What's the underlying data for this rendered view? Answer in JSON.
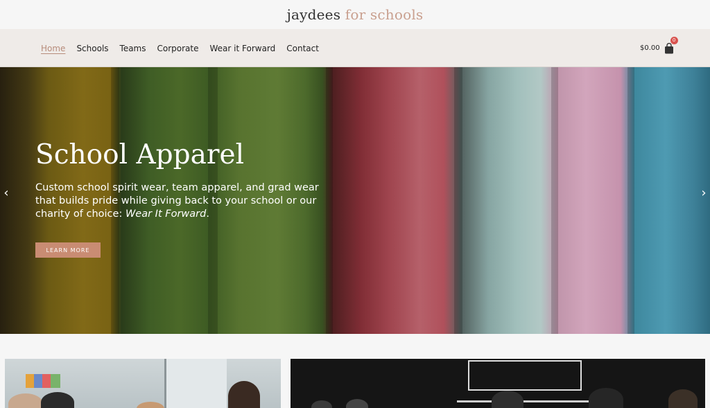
{
  "brand": {
    "logo_main": "jaydees",
    "logo_accent": "for schools",
    "accent_color": "#c9a08f"
  },
  "nav": {
    "items": [
      {
        "label": "Home",
        "active": true
      },
      {
        "label": "Schools",
        "active": false
      },
      {
        "label": "Teams",
        "active": false
      },
      {
        "label": "Corporate",
        "active": false
      },
      {
        "label": "Wear it Forward",
        "active": false
      },
      {
        "label": "Contact",
        "active": false
      }
    ],
    "cart_total": "$0.00",
    "cart_count": "0",
    "cart_icon": "shopping-bag-icon"
  },
  "hero": {
    "title": "School Apparel",
    "text_main": "Custom school spirit wear, team apparel, and grad wear that builds pride while giving back to your school or our charity of choice: ",
    "text_emphasis": "Wear It Forward",
    "text_end": ".",
    "button_label": "LEARN MORE",
    "button_color": "#c98c73",
    "prev_icon": "chevron-left-icon",
    "next_icon": "chevron-right-icon",
    "prev_glyph": "‹",
    "next_glyph": "›"
  }
}
